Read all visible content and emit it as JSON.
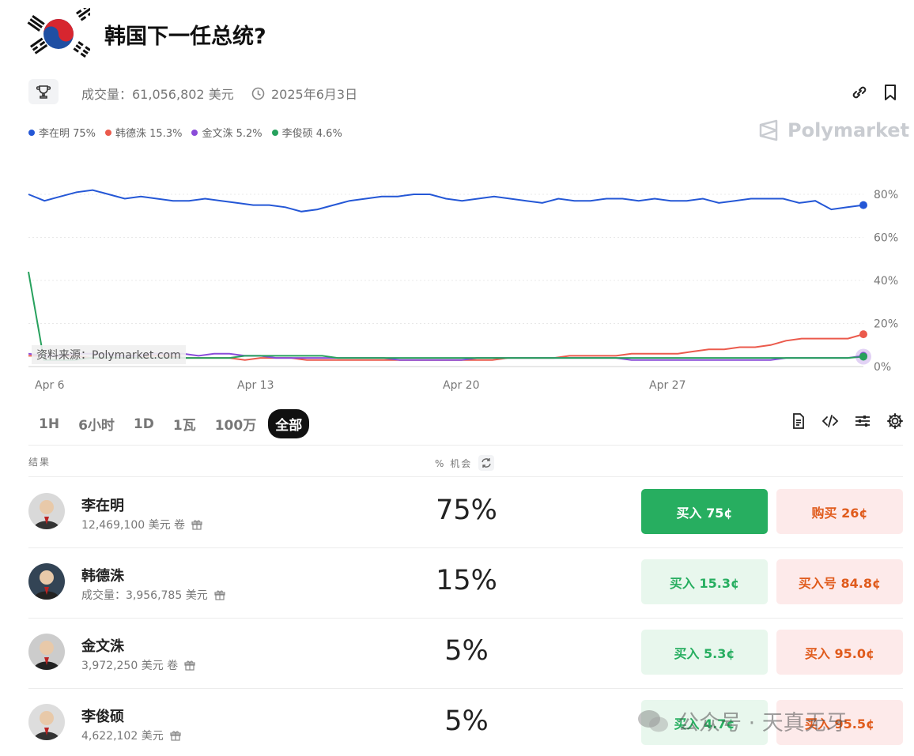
{
  "title": "韩国下一任总统?",
  "meta": {
    "volume_label": "成交量：61,056,802 美元",
    "date_label": "2025年6月3日"
  },
  "legend": [
    {
      "label": "李在明 75%",
      "color": "#2457d6"
    },
    {
      "label": "韩德洙 15.3%",
      "color": "#eb5a4c"
    },
    {
      "label": "金文洙 5.2%",
      "color": "#8a4cd9"
    },
    {
      "label": "李俊硕 4.6%",
      "color": "#27a15d"
    }
  ],
  "brand": "Polymarket",
  "source_note": "资料来源：Polymarket.com",
  "chart_data": {
    "type": "line",
    "x_labels": [
      "Apr 6",
      "Apr 13",
      "Apr 20",
      "Apr 27"
    ],
    "y_ticks": [
      "0%",
      "20%",
      "40%",
      "60%",
      "80%"
    ],
    "ylim": [
      0,
      80
    ],
    "series": [
      {
        "name": "李在明",
        "color": "#2457d6",
        "values": [
          80,
          77,
          79,
          81,
          82,
          80,
          78,
          79,
          78,
          77,
          77,
          78,
          77,
          76,
          75,
          75,
          74,
          72,
          73,
          75,
          77,
          78,
          79,
          79,
          80,
          80,
          78,
          77,
          78,
          79,
          78,
          77,
          76,
          78,
          77,
          77,
          78,
          78,
          77,
          78,
          77,
          77,
          78,
          76,
          77,
          78,
          78,
          78,
          76,
          77,
          73,
          74,
          75
        ]
      },
      {
        "name": "韩德洙",
        "color": "#eb5a4c",
        "values": [
          5,
          5,
          5,
          5,
          4,
          4,
          4,
          4,
          5,
          5,
          4,
          4,
          4,
          4,
          3,
          4,
          4,
          4,
          3,
          3,
          3,
          3,
          3,
          3,
          3,
          3,
          3,
          3,
          3,
          3,
          3,
          4,
          4,
          4,
          4,
          5,
          5,
          5,
          5,
          6,
          6,
          6,
          6,
          7,
          8,
          8,
          9,
          9,
          10,
          12,
          13,
          13,
          13,
          13,
          15
        ]
      },
      {
        "name": "金文洙",
        "color": "#8a4cd9",
        "values": [
          6,
          5,
          5,
          6,
          6,
          6,
          5,
          5,
          6,
          6,
          6,
          5,
          6,
          6,
          5,
          5,
          4,
          4,
          4,
          4,
          4,
          4,
          4,
          4,
          3,
          3,
          3,
          3,
          3,
          4,
          4,
          4,
          4,
          4,
          4,
          4,
          4,
          4,
          4,
          3,
          3,
          3,
          3,
          3,
          3,
          3,
          3,
          3,
          3,
          4,
          4,
          4,
          4,
          4,
          5
        ]
      },
      {
        "name": "李俊硕",
        "color": "#27a15d",
        "values": [
          44,
          3,
          3,
          3,
          4,
          4,
          4,
          4,
          4,
          4,
          4,
          4,
          4,
          4,
          5,
          5,
          5,
          5,
          5,
          5,
          4,
          4,
          4,
          4,
          4,
          4,
          4,
          4,
          4,
          4,
          4,
          4,
          4,
          4,
          4,
          4,
          4,
          4,
          4,
          4,
          4,
          4,
          4,
          4,
          4,
          4,
          4,
          4,
          4,
          4,
          4,
          4,
          4,
          4,
          4.6
        ]
      }
    ]
  },
  "tabs": [
    {
      "label": "1H",
      "active": false
    },
    {
      "label": "6小时",
      "active": false
    },
    {
      "label": "1D",
      "active": false
    },
    {
      "label": "1瓦",
      "active": false
    },
    {
      "label": "100万",
      "active": false
    },
    {
      "label": "全部",
      "active": true
    }
  ],
  "table": {
    "col_outcome": "结果",
    "col_chance": "% 机会"
  },
  "candidates": [
    {
      "name": "李在明",
      "volume": "12,469,100 美元 卷",
      "pct": "75%",
      "yes": "买入 75¢",
      "no": "购买 26¢",
      "yes_solid": true
    },
    {
      "name": "韩德洙",
      "volume": "成交量：3,956,785 美元",
      "pct": "15%",
      "yes": "买入 15.3¢",
      "no": "买入号 84.8¢",
      "yes_solid": false
    },
    {
      "name": "金文洙",
      "volume": "3,972,250 美元 卷",
      "pct": "5%",
      "yes": "买入 5.3¢",
      "no": "买入 95.0¢",
      "yes_solid": false
    },
    {
      "name": "李俊硕",
      "volume": "4,622,102 美元",
      "pct": "5%",
      "yes": "买入 4.7¢",
      "no": "买入 95.5¢",
      "yes_solid": false
    }
  ],
  "watermark": "公众号 · 天真无牙"
}
